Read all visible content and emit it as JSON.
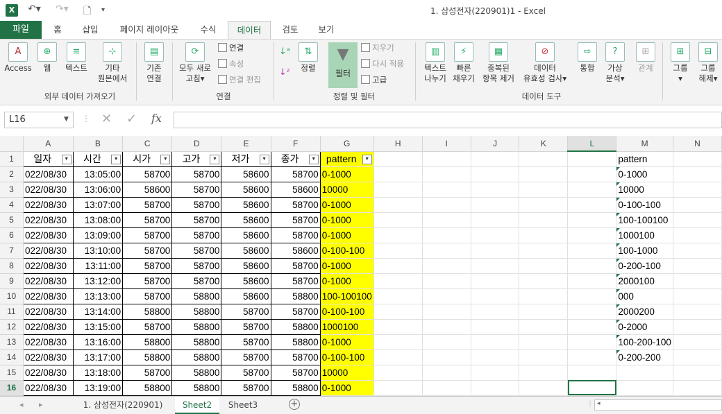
{
  "window": {
    "title": "1. 삼성전자(220901)1 - Excel",
    "app_icon": "X"
  },
  "tabs": [
    "파일",
    "홈",
    "삽입",
    "페이지 레이아웃",
    "수식",
    "데이터",
    "검토",
    "보기"
  ],
  "ribbon": {
    "ext_access": "Access",
    "ext_web": "웹",
    "ext_text": "텍스트",
    "ext_other1": "기타",
    "ext_other2": "원본에서",
    "group_ext": "외부 데이터 가져오기",
    "existing1": "기존",
    "existing2": "연결",
    "refresh1": "모두 새로",
    "refresh2": "고침",
    "conn": "연결",
    "props": "속성",
    "editlinks": "연결 편집",
    "group_conn": "연결",
    "sort": "정렬",
    "filter": "필터",
    "clear": "지우기",
    "reapply": "다시 적용",
    "advanced": "고급",
    "group_sort": "정렬 및 필터",
    "ttc1": "텍스트",
    "ttc2": "나누기",
    "flash1": "빠른",
    "flash2": "채우기",
    "dup1": "중복된",
    "dup2": "항목 제거",
    "valid1": "데이터",
    "valid2": "유효성 검사",
    "consol": "통합",
    "whatif1": "가상",
    "whatif2": "분석",
    "rel": "관계",
    "group_tools": "데이터 도구",
    "grp1": "그룹",
    "ungrp1": "그룹",
    "ungrp2": "해제"
  },
  "formula_bar": {
    "name_box": "L16",
    "fx": "fx",
    "value": ""
  },
  "columns": [
    "A",
    "B",
    "C",
    "D",
    "E",
    "F",
    "G",
    "H",
    "I",
    "J",
    "K",
    "L",
    "M",
    "N"
  ],
  "headers": {
    "A": "일자",
    "B": "시간",
    "C": "시가",
    "D": "고가",
    "E": "저가",
    "F": "종가",
    "G": "pattern",
    "M": "pattern"
  },
  "rows": [
    {
      "n": "2",
      "date": "022/08/30",
      "time": "13:05:00",
      "open": "58700",
      "high": "58700",
      "low": "58600",
      "close": "58700",
      "pattern": "0-1000",
      "m": "0-1000"
    },
    {
      "n": "3",
      "date": "022/08/30",
      "time": "13:06:00",
      "open": "58600",
      "high": "58700",
      "low": "58600",
      "close": "58600",
      "pattern": "10000",
      "m": "10000"
    },
    {
      "n": "4",
      "date": "022/08/30",
      "time": "13:07:00",
      "open": "58700",
      "high": "58700",
      "low": "58600",
      "close": "58700",
      "pattern": "0-1000",
      "m": "0-100-100"
    },
    {
      "n": "5",
      "date": "022/08/30",
      "time": "13:08:00",
      "open": "58700",
      "high": "58700",
      "low": "58600",
      "close": "58700",
      "pattern": "0-1000",
      "m": "100-100100"
    },
    {
      "n": "6",
      "date": "022/08/30",
      "time": "13:09:00",
      "open": "58700",
      "high": "58700",
      "low": "58600",
      "close": "58700",
      "pattern": "0-1000",
      "m": "1000100"
    },
    {
      "n": "7",
      "date": "022/08/30",
      "time": "13:10:00",
      "open": "58700",
      "high": "58700",
      "low": "58600",
      "close": "58600",
      "pattern": "0-100-100",
      "m": "100-1000"
    },
    {
      "n": "8",
      "date": "022/08/30",
      "time": "13:11:00",
      "open": "58700",
      "high": "58700",
      "low": "58600",
      "close": "58700",
      "pattern": "0-1000",
      "m": "0-200-100"
    },
    {
      "n": "9",
      "date": "022/08/30",
      "time": "13:12:00",
      "open": "58700",
      "high": "58700",
      "low": "58600",
      "close": "58700",
      "pattern": "0-1000",
      "m": "2000100"
    },
    {
      "n": "10",
      "date": "022/08/30",
      "time": "13:13:00",
      "open": "58700",
      "high": "58800",
      "low": "58600",
      "close": "58800",
      "pattern": "100-100100",
      "m": "000"
    },
    {
      "n": "11",
      "date": "022/08/30",
      "time": "13:14:00",
      "open": "58800",
      "high": "58800",
      "low": "58700",
      "close": "58700",
      "pattern": "0-100-100",
      "m": "2000200"
    },
    {
      "n": "12",
      "date": "022/08/30",
      "time": "13:15:00",
      "open": "58700",
      "high": "58800",
      "low": "58700",
      "close": "58800",
      "pattern": "1000100",
      "m": "0-2000"
    },
    {
      "n": "13",
      "date": "022/08/30",
      "time": "13:16:00",
      "open": "58800",
      "high": "58800",
      "low": "58700",
      "close": "58800",
      "pattern": "0-1000",
      "m": "100-200-100"
    },
    {
      "n": "14",
      "date": "022/08/30",
      "time": "13:17:00",
      "open": "58800",
      "high": "58800",
      "low": "58700",
      "close": "58700",
      "pattern": "0-100-100",
      "m": "0-200-200"
    },
    {
      "n": "15",
      "date": "022/08/30",
      "time": "13:18:00",
      "open": "58700",
      "high": "58800",
      "low": "58700",
      "close": "58700",
      "pattern": "10000",
      "m": ""
    },
    {
      "n": "16",
      "date": "022/08/30",
      "time": "13:19:00",
      "open": "58800",
      "high": "58800",
      "low": "58700",
      "close": "58800",
      "pattern": "0-1000",
      "m": ""
    }
  ],
  "sheets": [
    "1. 삼성전자(220901)",
    "Sheet2",
    "Sheet3"
  ],
  "active_sheet": "Sheet2",
  "colors": {
    "accent": "#217346",
    "highlight": "#ffff00"
  }
}
